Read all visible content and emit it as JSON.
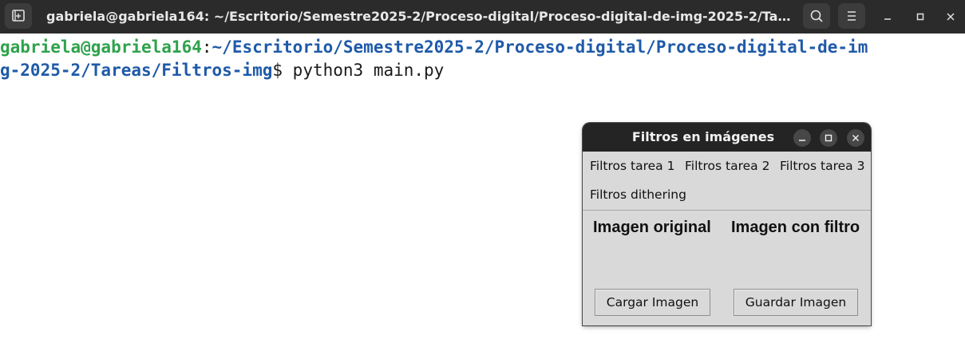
{
  "terminal": {
    "title": "gabriela@gabriela164: ~/Escritorio/Semestre2025-2/Proceso-digital/Proceso-digital-de-img-2025-2/Tare…",
    "icons": {
      "new_tab": "new-tab-icon",
      "search": "search-icon",
      "menu": "hamburger-menu-icon",
      "minimize": "minimize-icon",
      "maximize": "maximize-icon",
      "close": "close-icon"
    },
    "prompt": {
      "user_host": "gabriela@gabriela164",
      "colon": ":",
      "path_line1": "~/Escritorio/Semestre2025-2/Proceso-digital/Proceso-digital-de-im",
      "path_line2": "g-2025-2/Tareas/Filtros-img",
      "dollar": "$",
      "command": " python3 main.py"
    }
  },
  "tk_window": {
    "title": "Filtros en imágenes",
    "menu": [
      {
        "label": "Filtros tarea 1"
      },
      {
        "label": "Filtros tarea 2"
      },
      {
        "label": "Filtros tarea 3"
      },
      {
        "label": "Filtros dithering"
      }
    ],
    "original_label": "Imagen original",
    "filtered_label": "Imagen con filtro",
    "load_button": "Cargar Imagen",
    "save_button": "Guardar Imagen"
  }
}
